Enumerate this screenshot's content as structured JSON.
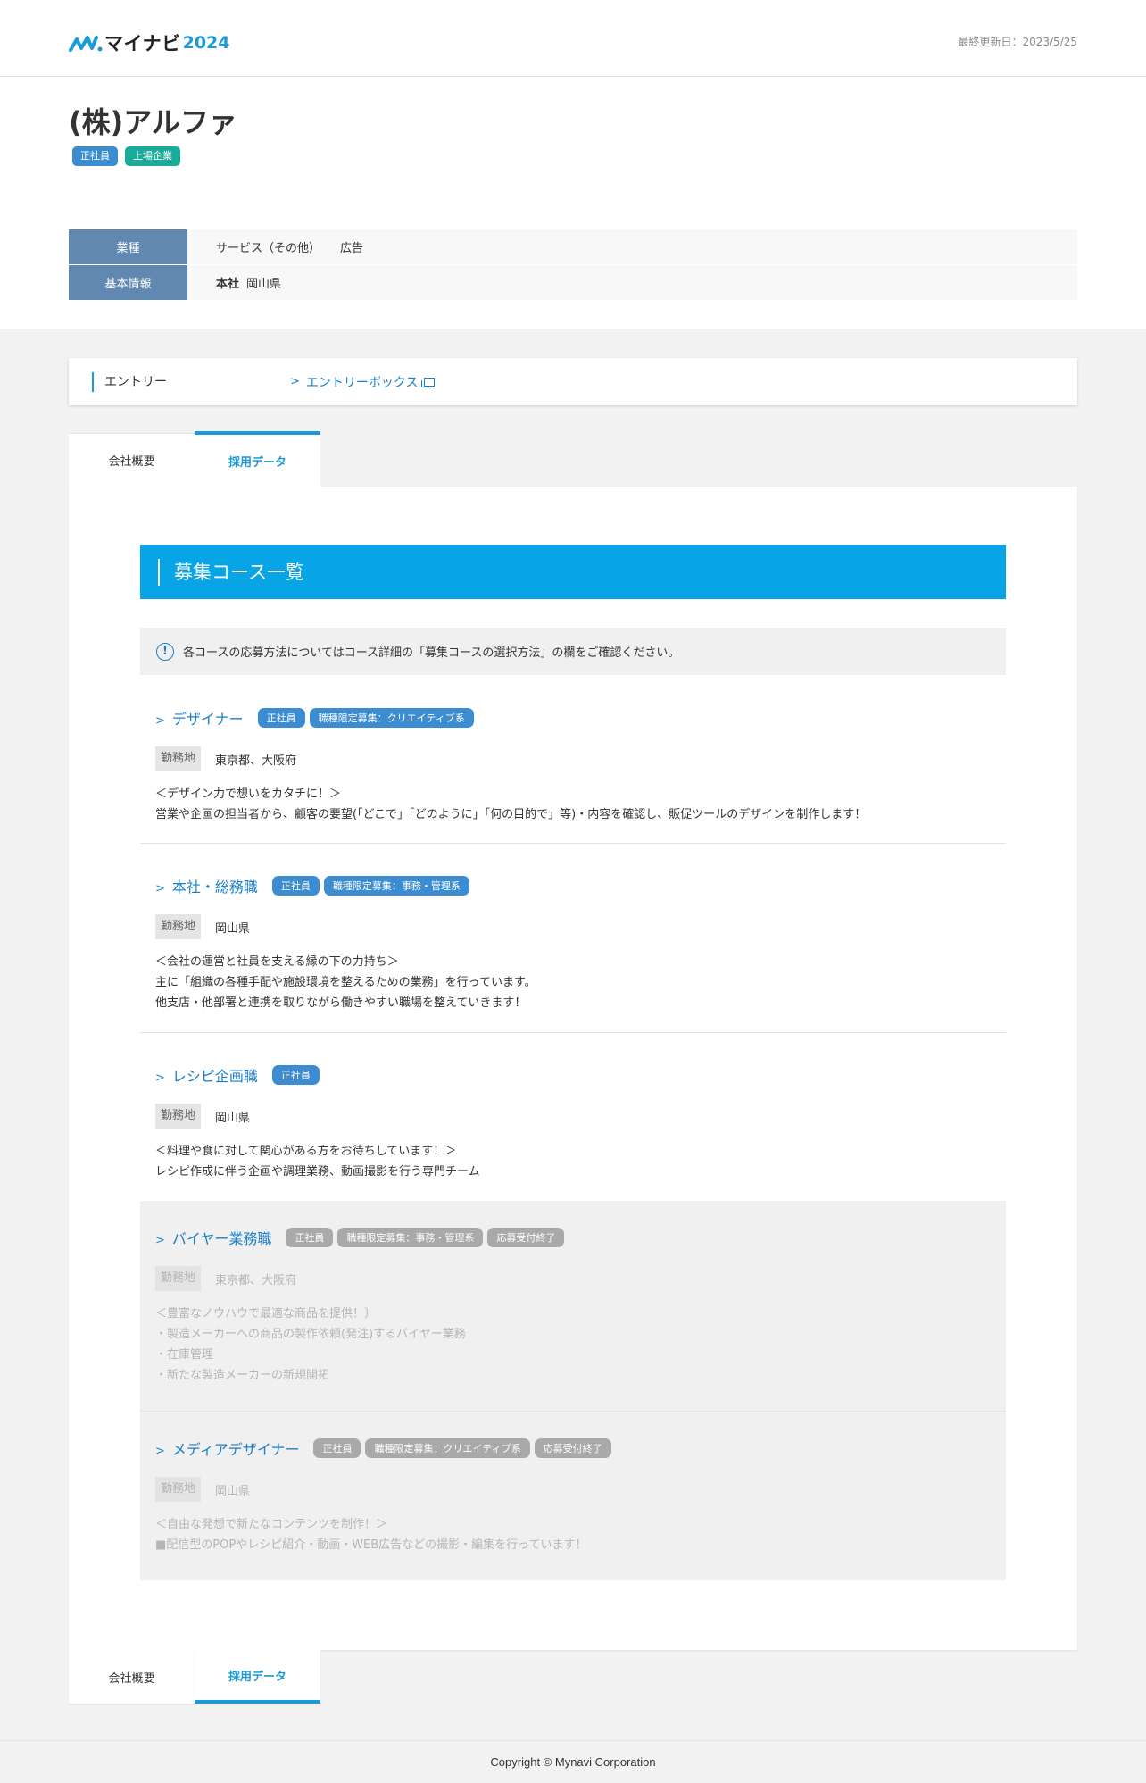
{
  "header": {
    "logo_text": "マイナビ",
    "logo_year": "2024",
    "updated": "最終更新日：2023/5/25"
  },
  "company": {
    "name": "(株)アルファ",
    "badges": [
      "正社員",
      "上場企業"
    ],
    "info": [
      {
        "label": "業種",
        "value_1": "サービス（その他）",
        "value_2": "広告"
      },
      {
        "label": "基本情報",
        "bold": "本社",
        "value_1": "岡山県"
      }
    ]
  },
  "entry": {
    "label": "エントリー",
    "link": "エントリーボックス"
  },
  "tabs": [
    "会社概要",
    "採用データ"
  ],
  "section_title": "募集コース一覧",
  "notice": "各コースの応募方法についてはコース詳細の「募集コースの選択方法」の欄をご確認ください。",
  "location_label": "勤務地",
  "courses": [
    {
      "title": "デザイナー",
      "tags": [
        "正社員",
        "職種限定募集：クリエイティブ系"
      ],
      "location": "東京都、大阪府",
      "desc": [
        "＜デザイン力で想いをカタチに！＞",
        "営業や企画の担当者から、顧客の要望(「どこで」「どのように」「何の目的で」等)・内容を確認し、販促ツールのデザインを制作します！"
      ]
    },
    {
      "title": "本社・総務職",
      "tags": [
        "正社員",
        "職種限定募集：事務・管理系"
      ],
      "location": "岡山県",
      "desc": [
        "＜会社の運営と社員を支える縁の下の力持ち＞",
        "主に「組織の各種手配や施設環境を整えるための業務」を行っています。",
        "他支店・他部署と連携を取りながら働きやすい職場を整えていきます！"
      ]
    },
    {
      "title": "レシピ企画職",
      "tags": [
        "正社員"
      ],
      "location": "岡山県",
      "desc": [
        "＜料理や食に対して関心がある方をお待ちしています！＞",
        "レシピ作成に伴う企画や調理業務、動画撮影を行う専門チーム"
      ]
    },
    {
      "title": "バイヤー業務職",
      "tags": [
        "正社員",
        "職種限定募集：事務・管理系",
        "応募受付終了"
      ],
      "location": "東京都、大阪府",
      "desc": [
        "＜豊富なノウハウで最適な商品を提供！〕",
        "・製造メーカーへの商品の製作依頼(発注)するバイヤー業務",
        "・在庫管理",
        "・新たな製造メーカーの新規開拓"
      ]
    },
    {
      "title": "メディアデザイナー",
      "tags": [
        "正社員",
        "職種限定募集：クリエイティブ系",
        "応募受付終了"
      ],
      "location": "岡山県",
      "desc": [
        "＜自由な発想で新たなコンテンツを制作！＞",
        "■配信型のPOPやレシピ紹介・動画・WEB広告などの撮影・編集を行っています！"
      ]
    }
  ],
  "footer": "Copyright © Mynavi Corporation",
  "colors": {
    "accent": "#08a5e6",
    "link": "#1a7fc8",
    "tag": "#3b8cd0",
    "tag_green": "#1aab9b",
    "tag_closed": "#a9a9a9"
  }
}
